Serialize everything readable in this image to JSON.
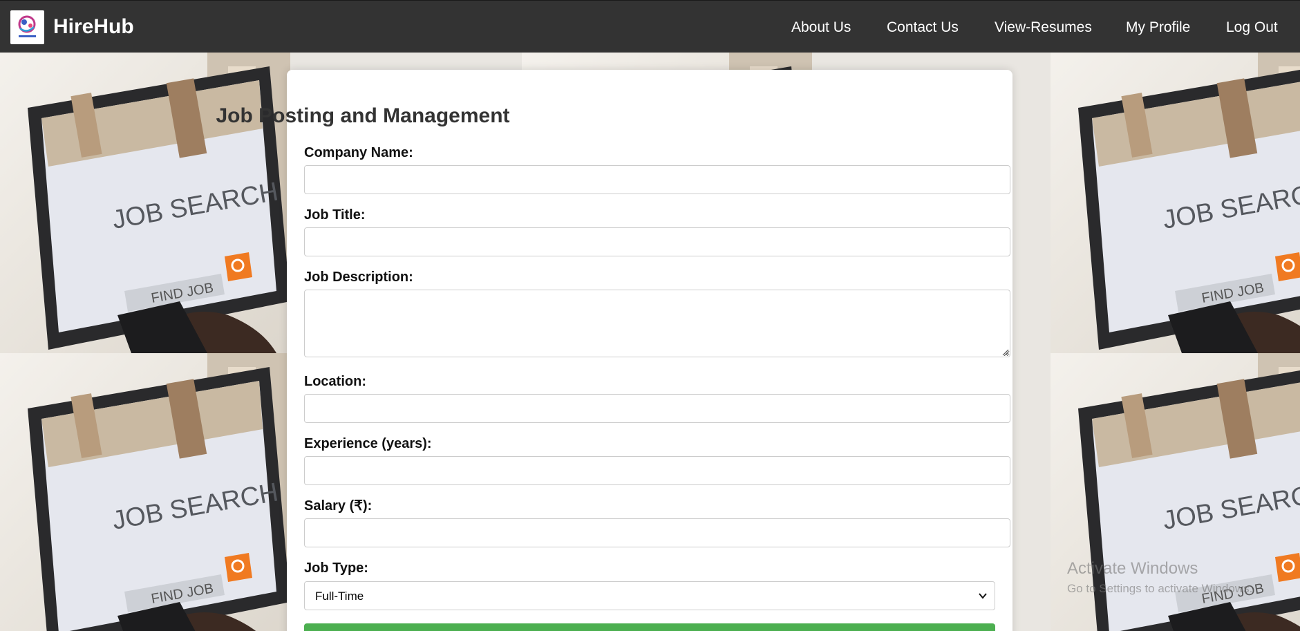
{
  "app": {
    "brand": "HireHub",
    "logo_icon": "hirehub-logo-icon"
  },
  "nav": {
    "about": "About Us",
    "contact": "Contact Us",
    "resumes": "View-Resumes",
    "profile": "My Profile",
    "logout": "Log Out"
  },
  "background": {
    "screen_text": "JOB SEARCH",
    "button_text": "FIND JOB"
  },
  "form": {
    "title": "Job Posting and Management",
    "company_label": "Company Name:",
    "company_value": "",
    "job_title_label": "Job Title:",
    "job_title_value": "",
    "description_label": "Job Description:",
    "description_value": "",
    "location_label": "Location:",
    "location_value": "",
    "experience_label": "Experience (years):",
    "experience_value": "",
    "salary_label": "Salary (₹):",
    "salary_value": "",
    "job_type_label": "Job Type:",
    "job_type_selected": "Full-Time"
  },
  "watermark": {
    "title": "Activate Windows",
    "subtitle": "Go to Settings to activate Windows."
  },
  "colors": {
    "navbar": "#333333",
    "submit": "#4caf50",
    "search_accent": "#f07a21"
  }
}
